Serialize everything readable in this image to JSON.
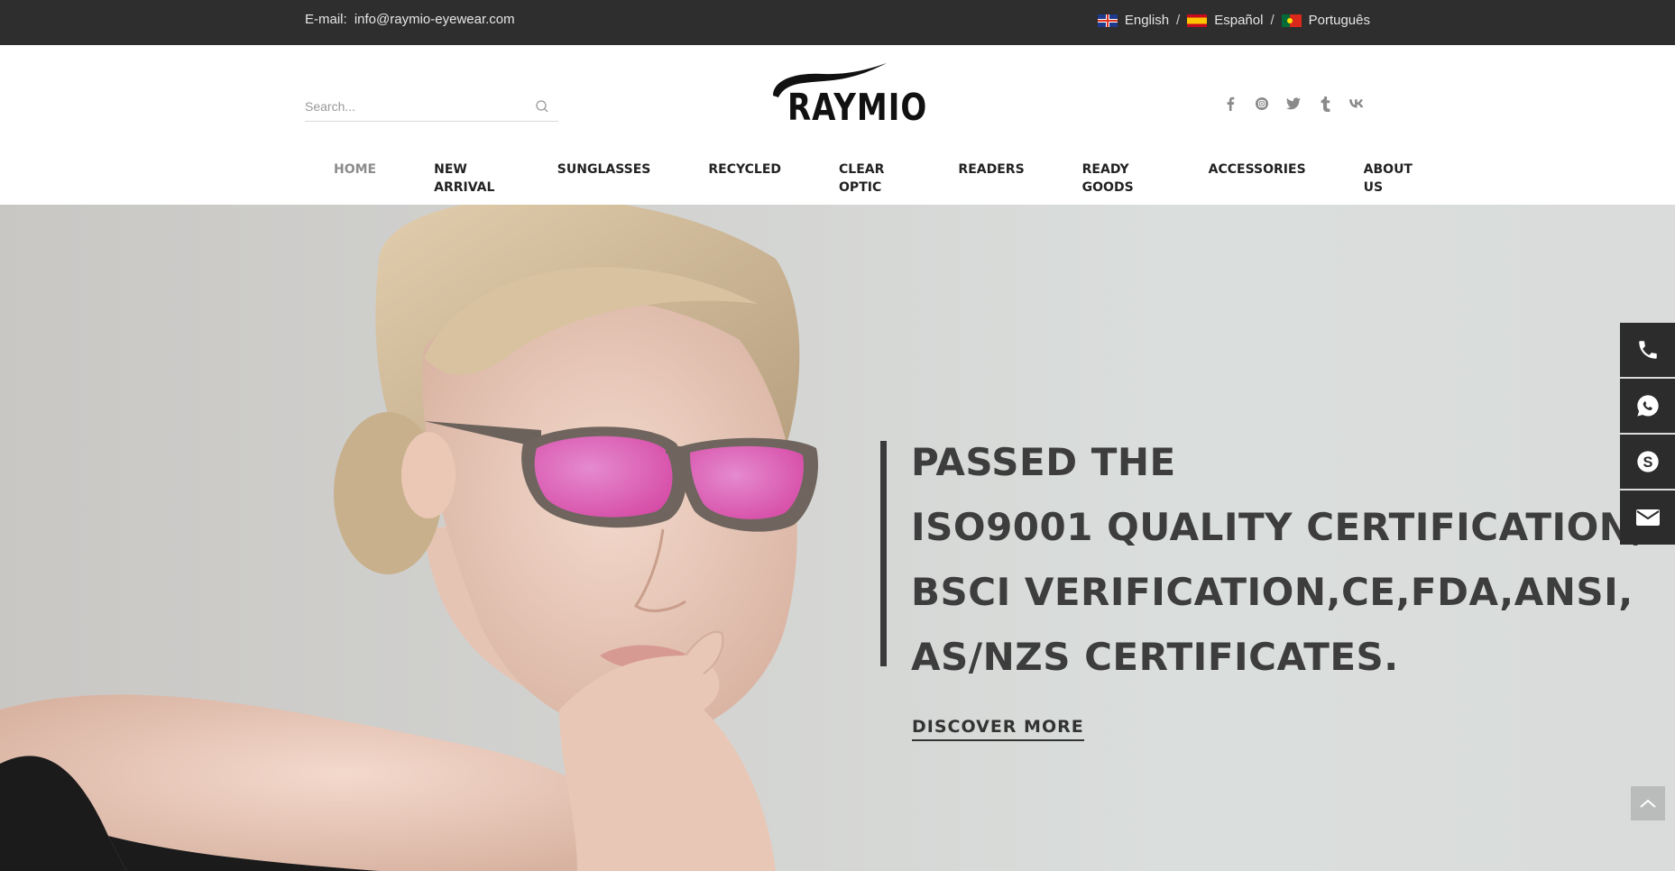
{
  "topbar": {
    "email_label": "E-mail:",
    "email": "info@raymio-eyewear.com",
    "languages": [
      {
        "label": "English",
        "flag": "uk-flag"
      },
      {
        "label": "Español",
        "flag": "spain-flag"
      },
      {
        "label": "Português",
        "flag": "portugal-flag"
      }
    ],
    "separator": "/"
  },
  "header": {
    "search_placeholder": "Search...",
    "logo_text": "RAYMIO",
    "social_icons": [
      "facebook-icon",
      "instagram-icon",
      "twitter-icon",
      "tumblr-icon",
      "vk-icon"
    ]
  },
  "nav": {
    "items": [
      "HOME",
      "NEW ARRIVAL",
      "SUNGLASSES",
      "RECYCLED",
      "CLEAR OPTIC",
      "READERS",
      "READY GOODS",
      "ACCESSORIES",
      "ABOUT US"
    ],
    "active": "HOME"
  },
  "hero": {
    "lines": [
      "PASSED THE",
      "ISO9001 QUALITY CERTIFICATION,",
      "BSCI VERIFICATION,CE,FDA,ANSI,",
      "AS/NZS CERTIFICATES."
    ],
    "cta": "DISCOVER MORE"
  },
  "side_contact": [
    "phone-icon",
    "whatsapp-icon",
    "skype-icon",
    "email-icon"
  ],
  "colors": {
    "topbar_bg": "#2e2e2e",
    "nav_active": "#8c8c8c",
    "side_bg": "#2c2c2c",
    "headline": "#3d3d3d"
  }
}
